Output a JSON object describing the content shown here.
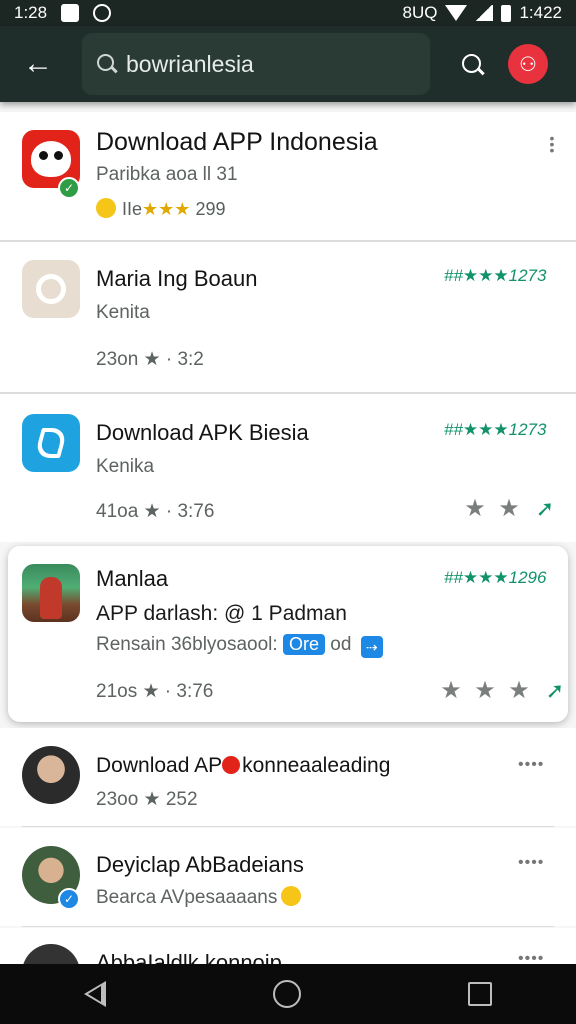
{
  "status_bar": {
    "time": "1:28",
    "right_text": "8UQ",
    "battery_text": "1:422"
  },
  "search": {
    "value": "bowrianlesia"
  },
  "apps": [
    {
      "title": "Download APP Indonesia",
      "subtitle": "Paribka aoa ll 31",
      "stars_prefix": "IIe",
      "stars": "★★★",
      "count": "299",
      "verified": true
    },
    {
      "title": "Maria Ing Boaun",
      "subtitle": "Kenita",
      "meta": "23on ★ · 3:2",
      "rating": "##★★★1273"
    },
    {
      "title": "Download APK Biesia",
      "subtitle": "Kenika",
      "meta": "41oa ★ · 3:76",
      "rating": "##★★★1273"
    },
    {
      "title": "Manlaa",
      "subtitle_line1": "APP darlash: @ 1 Padman",
      "subtitle_line2": "Rensain 36blyosaool:",
      "badge": "Ore",
      "badge_suffix": "od",
      "meta": "21os ★ · 3:76",
      "rating": "##★★★1296"
    },
    {
      "title": "Download AP",
      "title_suffix": "konneaaleading",
      "meta": "23oo ★ 252"
    },
    {
      "title": "Deyiclap AbBadeians",
      "subtitle": "Bearca AVpesaaaans"
    },
    {
      "title": "AbbaIaldlk konnoip"
    }
  ],
  "icons": {
    "back": "arrow-left-icon",
    "search": "search-icon",
    "profile": "profile-icon",
    "more": "more-vertical-icon",
    "star": "star-icon",
    "share": "send-icon"
  },
  "colors": {
    "app_bar": "#1f2e2a",
    "accent_green": "#12926b",
    "profile_red": "#e8333f"
  }
}
